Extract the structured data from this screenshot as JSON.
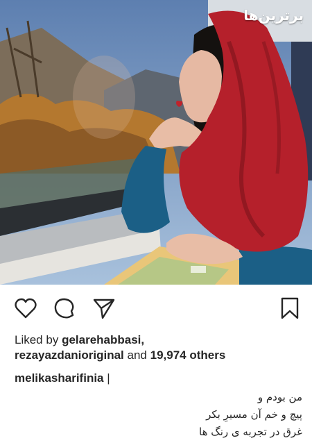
{
  "post": {
    "watermark": "برترین‌ها",
    "liked_by_prefix": "Liked by",
    "liker_1": "gelarehabbasi,",
    "liker_2": "rezayazdanioriginal",
    "and_word": "and",
    "others_count": "19,974 others",
    "caption_user": "melikasharifinia",
    "caption_lines": [
      "من بودم و",
      "پیچ و خم آن مسیرِ بکر",
      "غرق در تجربه ی رنگ ها"
    ]
  },
  "icons": {
    "like": "heart-icon",
    "comment": "speech-bubble-icon",
    "share": "paper-plane-icon",
    "save": "bookmark-icon"
  },
  "colors": {
    "text": "#262626",
    "scarf": "#b5202b",
    "sweater": "#1b5f86",
    "sky": "#6f8fb6"
  }
}
